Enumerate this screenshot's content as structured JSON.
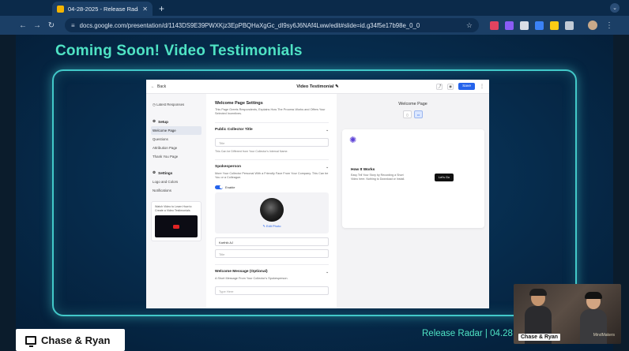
{
  "browser": {
    "tab_title": "04-28-2025 - Release Radar",
    "tab_close": "✕",
    "new_tab": "+",
    "url": "docs.google.com/presentation/d/1143DS9E39PWXKjz3EpPBQHaXgGc_dI9sy6J6NAf4Lww/edit#slide=id.g34f5e17b98e_0_0",
    "back_glyph": "←",
    "forward_glyph": "→",
    "reload_glyph": "↻",
    "star_glyph": "☆",
    "menu_glyph": "⋮",
    "icons": [
      "slides-favicon",
      "tune-icon",
      "star-icon",
      "extension-icons",
      "profile-avatar"
    ]
  },
  "slide": {
    "title": "Coming Soon! Video Testimonials",
    "footer_brand": "Release Radar | 04.28",
    "presenter_label": "Chase & Ryan",
    "webcam_label": "Chase & Ryan",
    "webcam_logo": "MindMakers"
  },
  "app": {
    "back_label": "Back",
    "title": "Video Testimonial ✎",
    "save_label": "Save",
    "more_glyph": "⋮",
    "sidebar": {
      "latest_responses": "Latest Responses",
      "setup_head": "Setup",
      "setup_items": [
        "Welcome Page",
        "Questions",
        "Attribution Page",
        "Thank You Page"
      ],
      "settings_head": "Settings",
      "settings_items": [
        "Logo and Colors",
        "Notifications"
      ],
      "video_card_text": "Watch Video to Learn How to Create a Video Testimonials"
    },
    "form": {
      "heading": "Welcome Page Settings",
      "subheading": "This Page Greets Respondents, Explains How The Process Works and Offers Your Selected Incentives.",
      "collector_title_head": "Public Collector Title",
      "title_placeholder": "Title",
      "title_hint": "This Can be Different from Your Collector's Internal Name.",
      "spokesperson_head": "Spokesperson",
      "spokesperson_desc": "More Your Collector Personal With a Friendly Face From Your Company. This Can be You or a Colleague.",
      "enable_label": "Enable",
      "edit_photo": "✎ Edit Photo",
      "name_value": "Karthik AJ",
      "title2_placeholder": "Title",
      "welcome_msg_head": "Welcome Message (Optional)",
      "welcome_msg_desc": "A Short Message From Your Collector's Spokesperson.",
      "type_here": "Type Here"
    },
    "preview": {
      "heading": "Welcome Page",
      "how_heading": "How It Works",
      "how_text": "Easy Tell Your Story by Recording a Short Video here. Nothing to Download or Install.",
      "cta_label": "Let's Go"
    }
  },
  "colors": {
    "title_teal": "#4fe3c4",
    "frame_glow": "#42c9c9",
    "save_blue": "#2563eb",
    "logo_purple": "#5b3fd6"
  }
}
